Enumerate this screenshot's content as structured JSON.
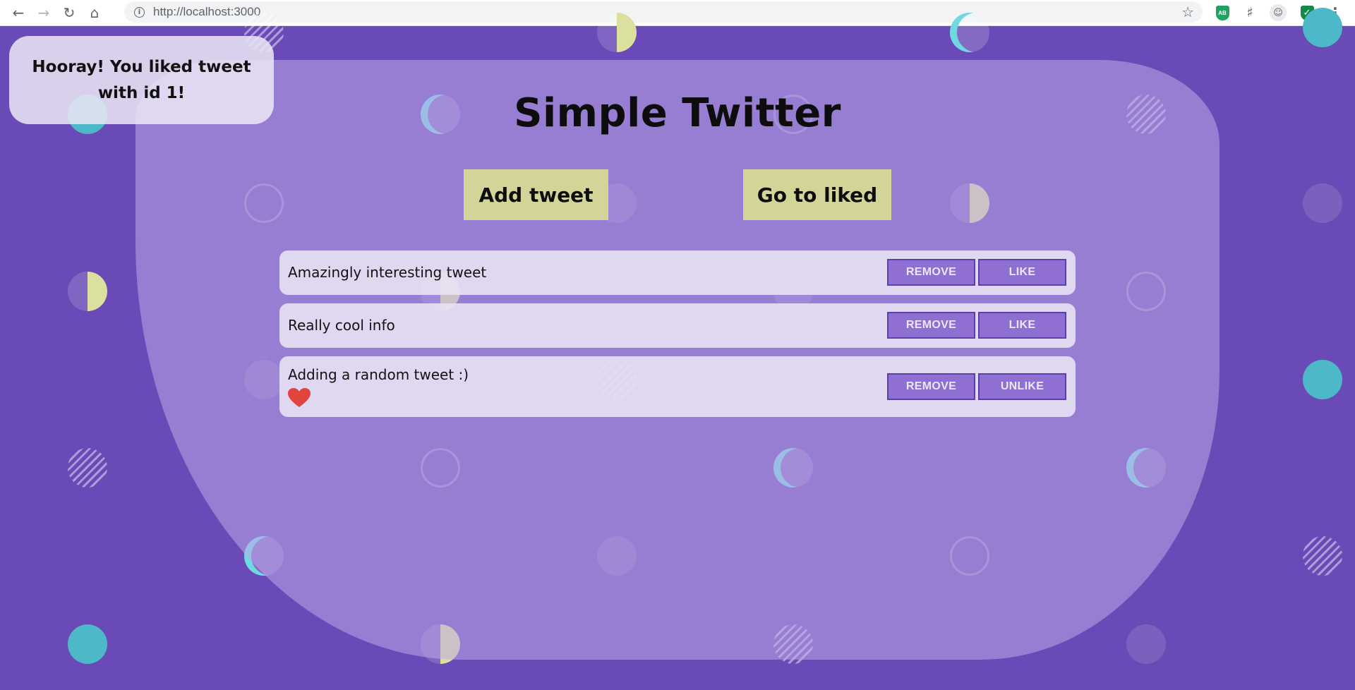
{
  "browser": {
    "url": "http://localhost:3000",
    "back_icon": "arrow-left",
    "forward_icon": "arrow-right",
    "reload_icon": "reload",
    "home_icon": "home",
    "info_icon": "info-circle",
    "bookmark_icon": "star",
    "extensions": [
      "adblock-extension",
      "puzzle-extension",
      "profile",
      "security-extension",
      "menu"
    ],
    "adblock_label": "AB"
  },
  "toast": {
    "message": "Hooray! You liked tweet with id 1!"
  },
  "header": {
    "title": "Simple Twitter"
  },
  "actions": {
    "add_tweet": "Add tweet",
    "go_to_liked": "Go to liked"
  },
  "tweets": [
    {
      "text": "Amazingly interesting tweet",
      "remove_label": "REMOVE",
      "like_label": "LIKE",
      "liked": false
    },
    {
      "text": "Really cool info",
      "remove_label": "REMOVE",
      "like_label": "LIKE",
      "liked": false
    },
    {
      "text": "Adding a random tweet :)",
      "remove_label": "REMOVE",
      "like_label": "UNLIKE",
      "liked": true
    }
  ],
  "colors": {
    "background": "#6a4ab6",
    "action_button": "#d3d598",
    "tweet_button": "#8f6fd1",
    "heart": "#e0443e"
  }
}
